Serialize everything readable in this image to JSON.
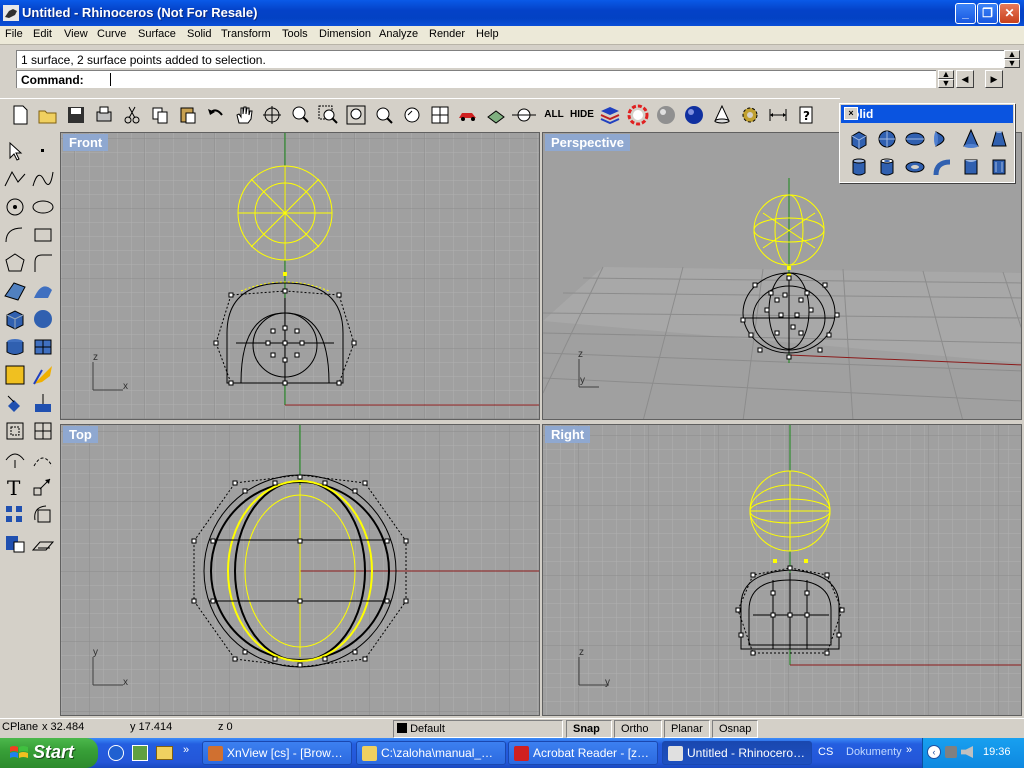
{
  "window": {
    "title": "Untitled - Rhinoceros (Not For Resale)"
  },
  "menu": [
    "File",
    "Edit",
    "View",
    "Curve",
    "Surface",
    "Solid",
    "Transform",
    "Tools",
    "Dimension",
    "Analyze",
    "Render",
    "Help"
  ],
  "command": {
    "history": "1 surface, 2 surface points added to selection.",
    "prompt": "Command:"
  },
  "toolbar": {
    "all_label": "ALL",
    "hide_label": "HIDE"
  },
  "viewports": {
    "front": "Front",
    "perspective": "Perspective",
    "top": "Top",
    "right": "Right"
  },
  "axes": {
    "x": "x",
    "y": "y",
    "z": "z"
  },
  "solid_toolbar": {
    "title": "Solid",
    "close": "×"
  },
  "status": {
    "cplane": "CPlane",
    "x": "x 32.484",
    "y": "y 17.414",
    "z": "z 0",
    "layer": "Default",
    "snap": "Snap",
    "ortho": "Ortho",
    "planar": "Planar",
    "osnap": "Osnap"
  },
  "taskbar": {
    "start": "Start",
    "tasks": [
      "XnView [cs] - [Brow…",
      "C:\\zaloha\\manual_…",
      "Acrobat Reader - [z…",
      "Untitled - Rhinocero…"
    ],
    "lang": "CS",
    "folder": "Dokumenty",
    "clock": "19:36"
  },
  "colors": {
    "viewport_bg": "#a0a0a0",
    "selection": "#ffff00",
    "x_axis": "#8b1a1a",
    "y_axis": "#1a8a1a",
    "label_bg": "#8fa8d0"
  }
}
